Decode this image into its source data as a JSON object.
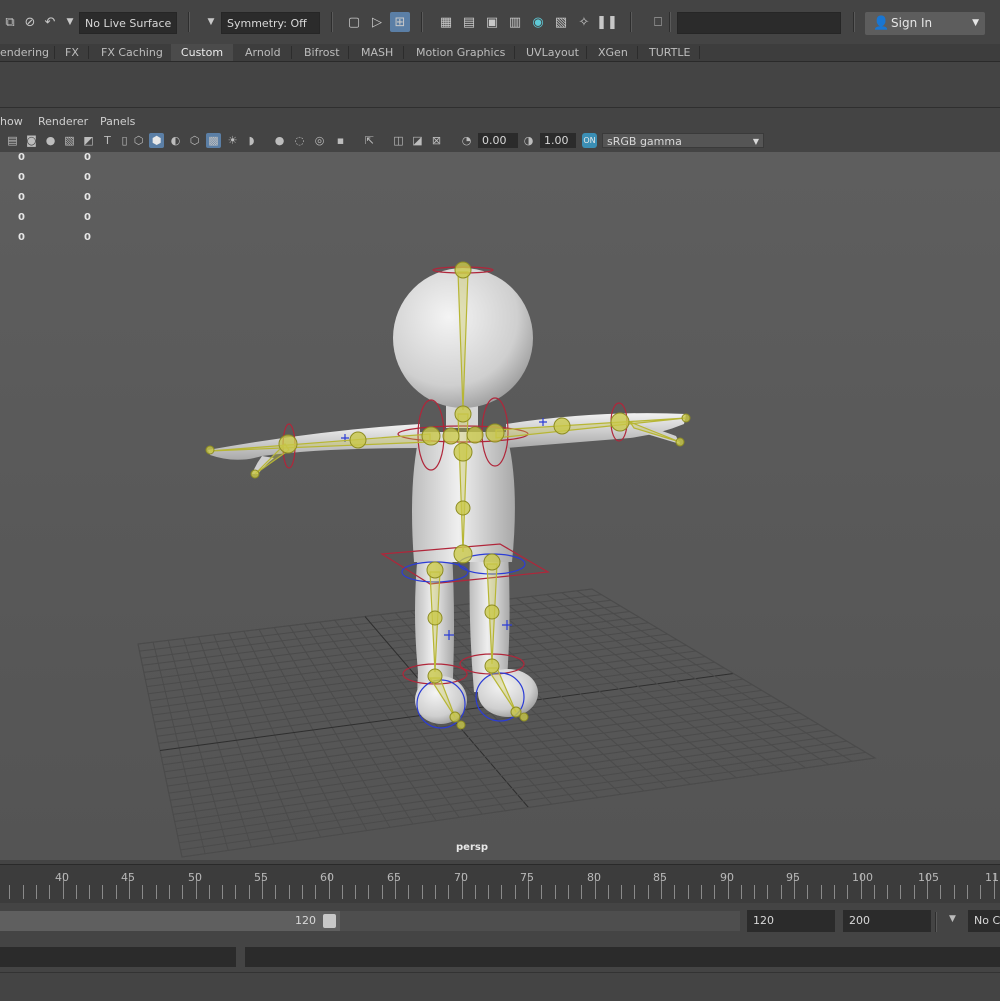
{
  "status_line": {
    "live_surface": "No Live Surface",
    "symmetry": "Symmetry: Off",
    "sign_in": "Sign In"
  },
  "shelf_tabs": [
    "endering",
    "FX",
    "FX Caching",
    "Custom",
    "Arnold",
    "Bifrost",
    "MASH",
    "Motion Graphics",
    "UVLayout",
    "XGen",
    "TURTLE"
  ],
  "shelf_active_tab": "Custom",
  "panel_menu": [
    "how",
    "Renderer",
    "Panels"
  ],
  "panel_toolbar": {
    "exposure": "0.00",
    "gamma": "1.00",
    "color_space": "sRGB gamma"
  },
  "hud": {
    "rows": [
      [
        "0",
        "0"
      ],
      [
        "0",
        "0"
      ],
      [
        "0",
        "0"
      ],
      [
        "0",
        "0"
      ],
      [
        "0",
        "0"
      ]
    ]
  },
  "viewport": {
    "camera": "persp"
  },
  "time_slider": {
    "labels": [
      "40",
      "45",
      "50",
      "55",
      "60",
      "65",
      "70",
      "75",
      "80",
      "85",
      "90",
      "95",
      "100",
      "105",
      "11"
    ]
  },
  "range_slider": {
    "inner_end": "120",
    "end_time": "120",
    "total_end": "200",
    "character_set": "No C"
  }
}
